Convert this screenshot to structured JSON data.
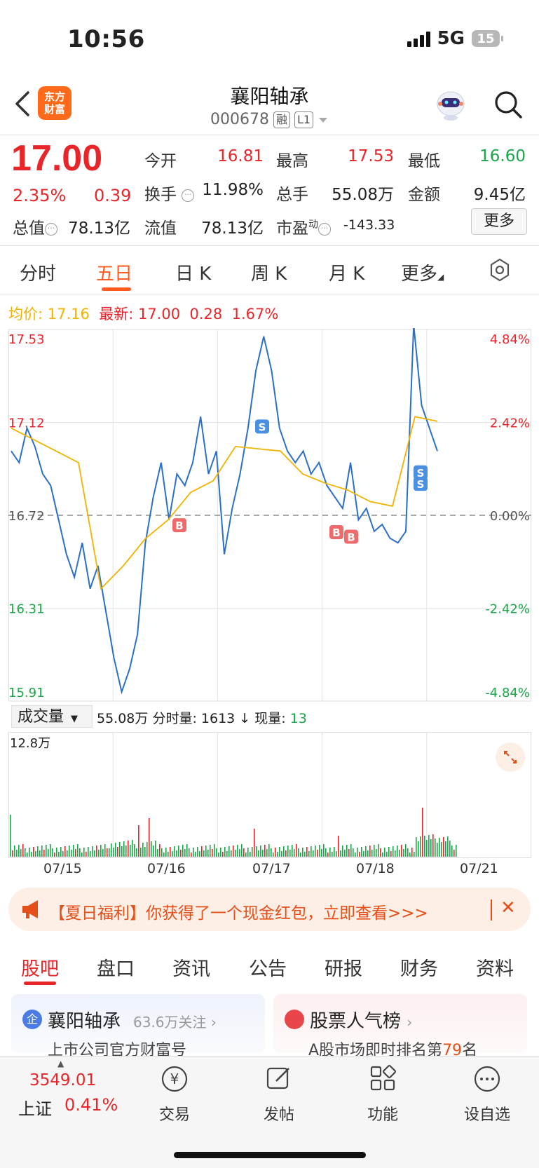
{
  "status_bar": {
    "time": "10:56",
    "network": "5G",
    "battery": "15"
  },
  "header": {
    "logo_line1": "东方",
    "logo_line2": "财富",
    "stock_name": "襄阳轴承",
    "stock_code": "000678",
    "tag_margin": "融",
    "tag_level": "L1"
  },
  "quote": {
    "price": "17.00",
    "change_pct": "2.35%",
    "change": "0.39",
    "open_label": "今开",
    "open": "16.81",
    "high_label": "最高",
    "high": "17.53",
    "low_label": "最低",
    "low": "16.60",
    "turnover_label": "换手",
    "turnover": "11.98%",
    "volume_label": "总手",
    "volume": "55.08万",
    "amount_label": "金额",
    "amount": "9.45亿",
    "mktcap_label": "总值",
    "mktcap": "78.13亿",
    "float_label": "流值",
    "float_cap": "78.13亿",
    "pe_label": "市盈",
    "pe_sup": "动",
    "pe": "-143.33",
    "more_button": "更多"
  },
  "chart_tabs": [
    "分时",
    "五日",
    "日 K",
    "周 K",
    "月 K",
    "更多"
  ],
  "chart_header": {
    "avg_label": "均价:",
    "avg": "17.16",
    "latest_label": "最新:",
    "latest": "17.00",
    "chg": "0.28",
    "chg_pct": "1.67%"
  },
  "volume_header": {
    "selector": "成交量",
    "total": "55.08万",
    "tick_label": "分时量:",
    "tick": "1613 ↓",
    "now_label": "现量:",
    "now": "13",
    "max_label": "12.8万"
  },
  "colors": {
    "up": "#e8262a",
    "down": "#1ba64a",
    "price_line": "#2c6fc7",
    "avg_line": "#f0b400",
    "accent": "#ff5a1f"
  },
  "chart_data": {
    "type": "line",
    "x": [
      "07/15",
      "07/16",
      "07/17",
      "07/18",
      "07/21"
    ],
    "ylim": [
      15.91,
      17.53
    ],
    "y_ticks": [
      "17.53",
      "17.12",
      "16.72",
      "16.31",
      "15.91"
    ],
    "pct_ticks": [
      "4.84%",
      "2.42%",
      "0.00%",
      "-2.42%",
      "-4.84%"
    ],
    "prev_close": 16.72,
    "series": [
      {
        "name": "",
        "color": "#2c6fc7",
        "values": [
          17.0,
          16.95,
          17.1,
          17.02,
          16.9,
          16.85,
          16.7,
          16.55,
          16.45,
          16.6,
          16.4,
          16.5,
          16.3,
          16.1,
          15.95,
          16.05,
          16.2,
          16.6,
          16.8,
          16.95,
          16.7,
          16.9,
          16.85,
          16.95,
          17.15,
          16.9,
          17.0,
          16.55,
          16.75,
          16.9,
          17.1,
          17.35,
          17.5,
          17.35,
          17.1,
          17.0,
          16.95,
          17.0,
          16.9,
          16.95,
          16.85,
          16.8,
          16.75,
          16.95,
          16.7,
          16.75,
          16.65,
          16.68,
          16.62,
          16.6,
          16.65,
          17.55,
          17.2,
          17.1,
          17.0
        ]
      },
      {
        "name": "",
        "color": "#f0b400",
        "values": [
          17.1,
          17.05,
          17.0,
          16.95,
          16.4,
          16.5,
          16.62,
          16.7,
          16.82,
          16.87,
          17.02,
          17.01,
          17.0,
          16.9,
          16.86,
          16.83,
          16.78,
          16.76,
          17.15,
          17.13
        ]
      }
    ],
    "volume_ylim": [
      0,
      128000
    ],
    "markers": [
      "B",
      "S",
      "B",
      "B",
      "S",
      "S"
    ]
  },
  "banner": {
    "text": "【夏日福利】你获得了一个现金红包，立即查看>>>"
  },
  "bottom_tabs": [
    "股吧",
    "盘口",
    "资讯",
    "公告",
    "研报",
    "财务",
    "资料"
  ],
  "cards": {
    "left_title": "襄阳轴承",
    "left_follow": "63.6万关注",
    "left_sub": "上市公司官方财富号",
    "right_title": "股票人气榜",
    "right_sub_pre": "A股市场即时排名第",
    "right_rank": "79",
    "right_sub_post": "名"
  },
  "footer": {
    "index_value": "3549.01",
    "index_name": "上证",
    "index_pct": "0.41%",
    "trade": "交易",
    "post": "发帖",
    "func": "功能",
    "watch": "设自选"
  }
}
